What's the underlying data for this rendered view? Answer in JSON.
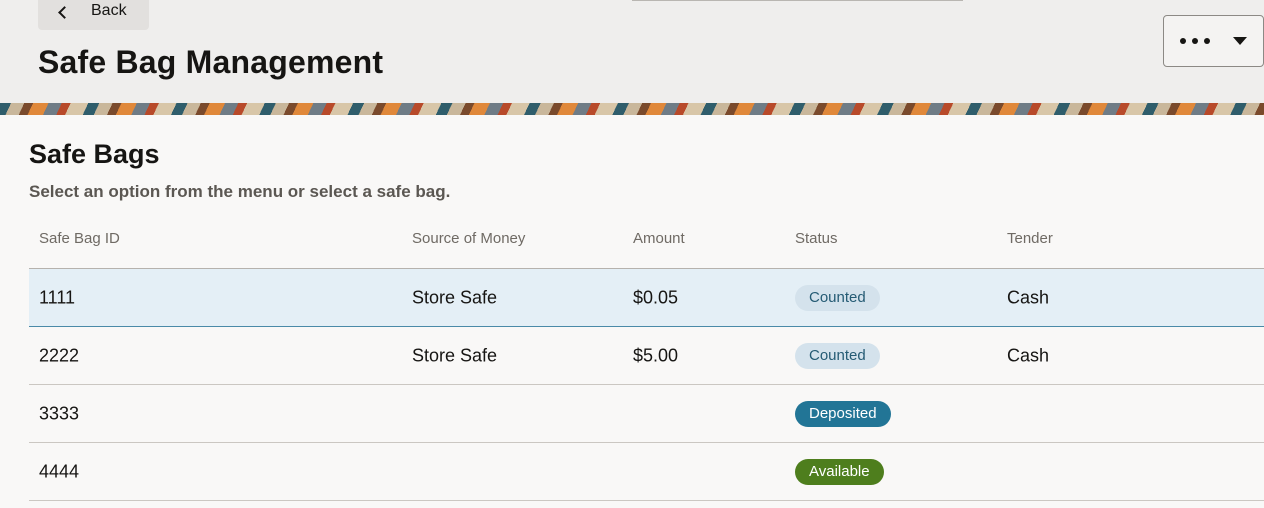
{
  "header": {
    "back_label": "Back",
    "title": "Safe Bag Management"
  },
  "section": {
    "title": "Safe Bags",
    "instructions": "Select an option from the menu or select a safe bag."
  },
  "table": {
    "columns": [
      "Safe Bag ID",
      "Source of Money",
      "Amount",
      "Status",
      "Tender"
    ],
    "rows": [
      {
        "id": "1111",
        "source": "Store Safe",
        "amount": "$0.05",
        "status": "Counted",
        "tender": "Cash"
      },
      {
        "id": "2222",
        "source": "Store Safe",
        "amount": "$5.00",
        "status": "Counted",
        "tender": "Cash"
      },
      {
        "id": "3333",
        "source": "",
        "amount": "",
        "status": "Deposited",
        "tender": ""
      },
      {
        "id": "4444",
        "source": "",
        "amount": "",
        "status": "Available",
        "tender": ""
      }
    ]
  },
  "colors": {
    "selected_row": "#e4eff6",
    "counted_badge": "#d4e2ec",
    "deposited_badge": "#227596",
    "available_badge": "#4e7e1d"
  },
  "icons": {
    "back": "chevron-left-icon",
    "more": "more-horizontal-icon",
    "dropdown": "caret-down-icon"
  }
}
